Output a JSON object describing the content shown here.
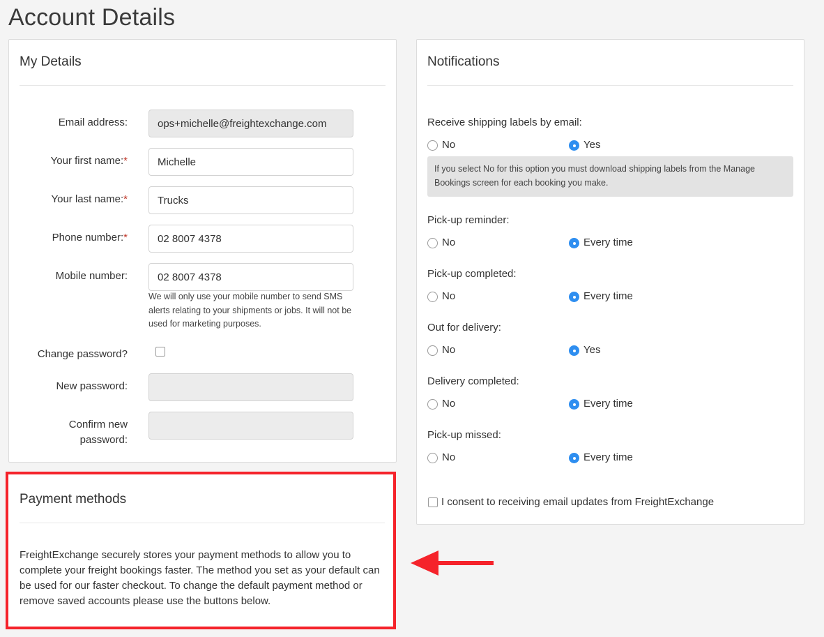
{
  "page": {
    "title": "Account Details"
  },
  "details": {
    "title": "My Details",
    "email_label": "Email address:",
    "email_value": "ops+michelle@freightexchange.com",
    "first_name_label": "Your first name:",
    "first_name_value": "Michelle",
    "last_name_label": "Your last name:",
    "last_name_value": "Trucks",
    "phone_label": "Phone number:",
    "phone_value": "02 8007 4378",
    "mobile_label": "Mobile number:",
    "mobile_value": "02 8007 4378",
    "mobile_help": "We will only use your mobile number to send SMS alerts relating to your shipments or jobs. It will not be used for marketing purposes.",
    "required_mark": "*",
    "change_password_label": "Change password?",
    "change_password_checked": false,
    "new_password_label": "New password:",
    "confirm_password_label_1": "Confirm new",
    "confirm_password_label_2": "password:"
  },
  "notifications": {
    "title": "Notifications",
    "labels_q": "Receive shipping labels by email:",
    "labels_no": "No",
    "labels_yes": "Yes",
    "labels_info": "If you select No for this option you must download shipping labels from the Manage Bookings screen for each booking you make.",
    "pickup_reminder_q": "Pick-up reminder:",
    "pickup_reminder_no": "No",
    "pickup_reminder_yes": "Every time",
    "pickup_completed_q": "Pick-up completed:",
    "pickup_completed_no": "No",
    "pickup_completed_yes": "Every time",
    "out_for_delivery_q": "Out for delivery:",
    "out_for_delivery_no": "No",
    "out_for_delivery_yes": "Yes",
    "delivery_completed_q": "Delivery completed:",
    "delivery_completed_no": "No",
    "delivery_completed_yes": "Every time",
    "pickup_missed_q": "Pick-up missed:",
    "pickup_missed_no": "No",
    "pickup_missed_yes": "Every time",
    "consent_label": "I consent to receiving email updates from FreightExchange",
    "consent_checked": false
  },
  "payment": {
    "title": "Payment methods",
    "description": "FreightExchange securely stores your payment methods to allow you to complete your freight bookings faster. The method you set as your default can be used for our faster checkout. To change the default payment method or remove saved accounts please use the buttons below."
  },
  "colors": {
    "accent": "#2e8ef0",
    "highlight": "#f5232b",
    "required": "#c0392b"
  }
}
